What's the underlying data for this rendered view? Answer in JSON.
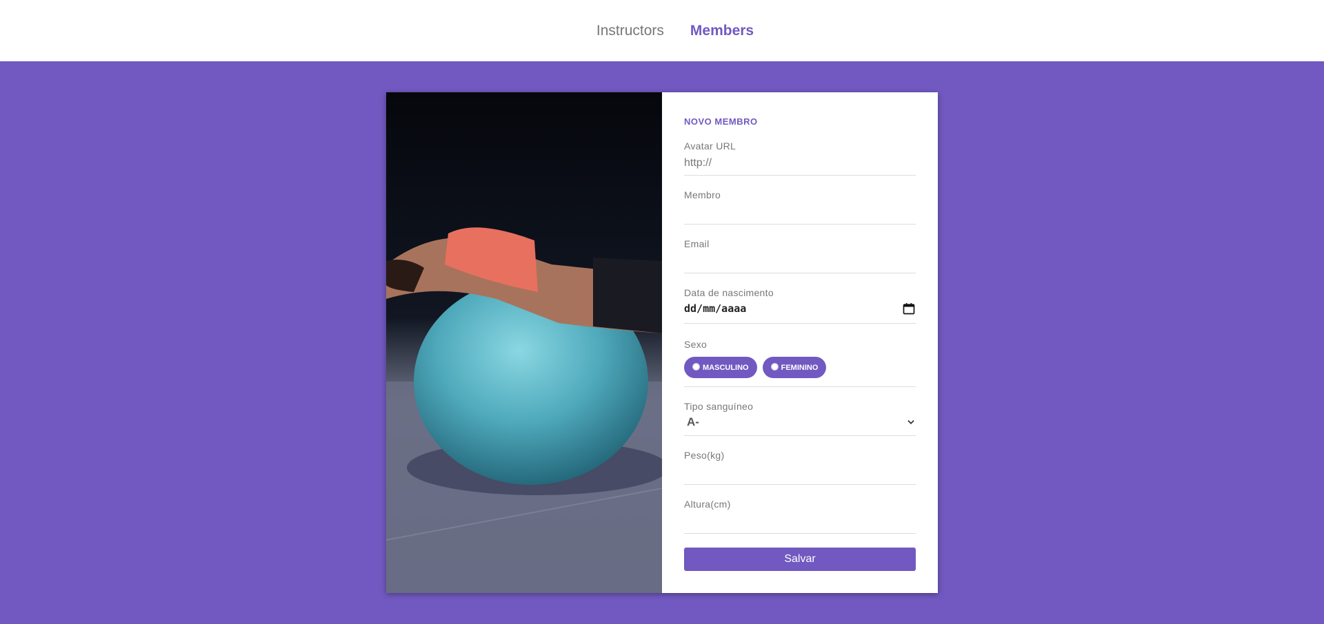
{
  "nav": {
    "items": [
      {
        "label": "Instructors",
        "active": false
      },
      {
        "label": "Members",
        "active": true
      }
    ]
  },
  "form": {
    "title": "NOVO MEMBRO",
    "avatar": {
      "label": "Avatar URL",
      "placeholder": "http://",
      "value": ""
    },
    "member": {
      "label": "Membro",
      "value": ""
    },
    "email": {
      "label": "Email",
      "value": ""
    },
    "birth": {
      "label": "Data de nascimento",
      "placeholder": "dd/mm/aaaa",
      "icon": "calendar-icon"
    },
    "gender": {
      "label": "Sexo",
      "options": [
        "MASCULINO",
        "FEMININO"
      ]
    },
    "blood": {
      "label": "Tipo sanguíneo",
      "selected": "A-",
      "icon": "chevron-down-icon"
    },
    "weight": {
      "label": "Peso(kg)",
      "value": ""
    },
    "height": {
      "label": "Altura(cm)",
      "value": ""
    },
    "submit_label": "Salvar"
  },
  "colors": {
    "accent": "#7159c1",
    "background": "#7159c1",
    "text_muted": "#777777"
  }
}
